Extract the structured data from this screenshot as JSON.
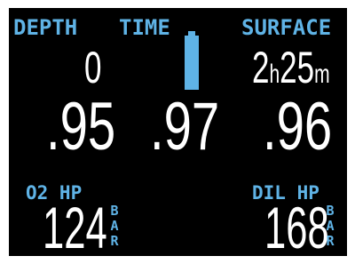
{
  "header": {
    "depth_label": "DEPTH",
    "time_label": "TIME",
    "surface_label": "SURFACE"
  },
  "values": {
    "depth": "0",
    "surface_hours": "2",
    "surface_hours_unit": "h",
    "surface_minutes": "25",
    "surface_minutes_unit": "m"
  },
  "battery": {
    "level_fraction": 1.0,
    "color": "#5fb3e6"
  },
  "ppo2": {
    "sensor1": ".95",
    "sensor2": ".97",
    "sensor3": ".96"
  },
  "pressures": {
    "o2_label": "O2 HP",
    "o2_value": "124",
    "dil_label": "DIL HP",
    "dil_value": "168",
    "unit_letters": [
      "B",
      "A",
      "R"
    ]
  },
  "colors": {
    "label": "#5fb3e6",
    "value": "#ffffff",
    "background": "#000000"
  }
}
